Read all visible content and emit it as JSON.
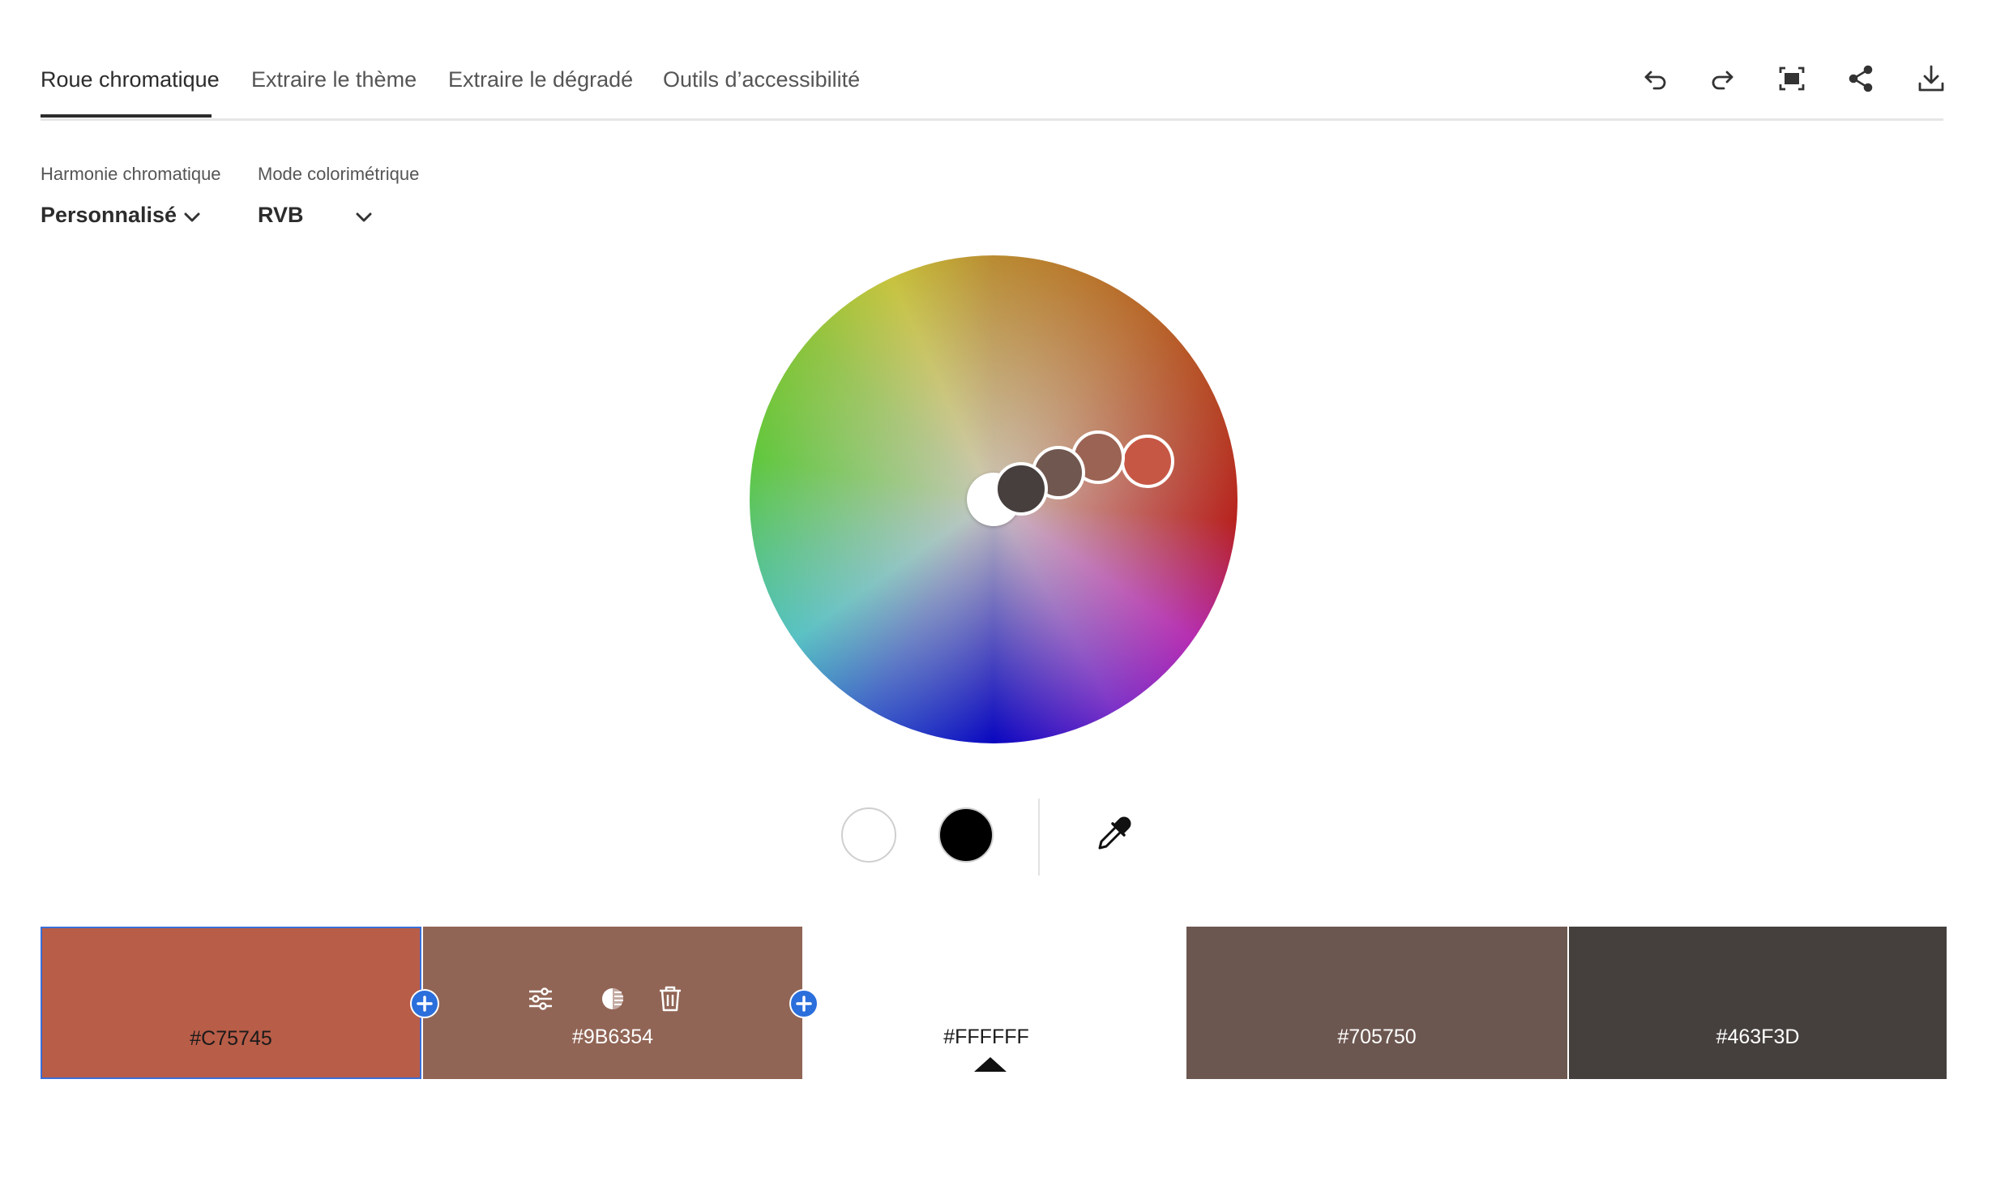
{
  "tabs": [
    {
      "label": "Roue chromatique",
      "active": true
    },
    {
      "label": "Extraire le thème",
      "active": false
    },
    {
      "label": "Extraire le dégradé",
      "active": false
    },
    {
      "label": "Outils d’accessibilité",
      "active": false
    }
  ],
  "toolbar": {
    "icons": [
      "undo-icon",
      "redo-icon",
      "fullscreen-icon",
      "share-icon",
      "download-icon"
    ]
  },
  "harmony": {
    "label": "Harmonie chromatique",
    "value": "Personnalisé"
  },
  "color_mode": {
    "label": "Mode colorimétrique",
    "value": "RVB"
  },
  "wheel": {
    "handles": [
      {
        "color": "#FFFFFF",
        "role": "base"
      },
      {
        "color": "#463F3D"
      },
      {
        "color": "#705750"
      },
      {
        "color": "#9B6354"
      },
      {
        "color": "#C75745"
      }
    ]
  },
  "quick_colors": {
    "white": "#FFFFFF",
    "black": "#000000",
    "eyedropper_icon": "eyedropper-icon"
  },
  "palette": [
    {
      "hex": "#C75745",
      "bg": "#B85D48",
      "text_color": "#1a1a1a",
      "selected": true
    },
    {
      "hex": "#9B6354",
      "bg": "#916555",
      "text_color": "#ffffff",
      "selected": false
    },
    {
      "hex": "#FFFFFF",
      "bg": "#FFFFFF",
      "text_color": "#1a1a1a",
      "selected": false,
      "base": true
    },
    {
      "hex": "#705750",
      "bg": "#6C5750",
      "text_color": "#ffffff",
      "selected": false
    },
    {
      "hex": "#463F3D",
      "bg": "#45403D",
      "text_color": "#ffffff",
      "selected": false
    }
  ],
  "swatch_tool_icons": [
    "sliders-icon",
    "contrast-icon",
    "trash-icon"
  ]
}
